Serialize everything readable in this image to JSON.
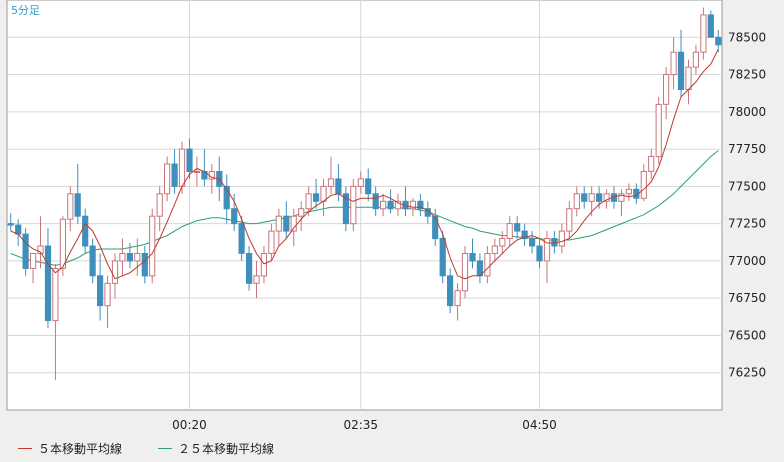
{
  "chart_data": {
    "type": "candlestick",
    "period_label": "5分足",
    "ylim": [
      76000,
      78750
    ],
    "y_ticks": [
      76250,
      76500,
      76750,
      77000,
      77250,
      77500,
      77750,
      78000,
      78250,
      78500
    ],
    "x_ticks": [
      {
        "index": 24,
        "label": "00:20"
      },
      {
        "index": 47,
        "label": "02:35"
      },
      {
        "index": 71,
        "label": "04:50"
      }
    ],
    "grid": true,
    "colors": {
      "up_border": "#c9747a",
      "down_fill": "#3f8fbd",
      "ma5": "#c0392b",
      "ma25": "#2e9e7a",
      "grid": "#d7d7d7",
      "plot_bg": "#ffffff"
    },
    "legend": [
      {
        "label": "５本移動平均線",
        "color": "#c0392b"
      },
      {
        "label": "２５本移動平均線",
        "color": "#2e9e7a"
      }
    ],
    "candles": [
      [
        77250,
        77320,
        77200,
        77240
      ],
      [
        77240,
        77280,
        77100,
        77180
      ],
      [
        77180,
        77220,
        76900,
        76950
      ],
      [
        76950,
        77050,
        76850,
        77050
      ],
      [
        77050,
        77300,
        76950,
        77100
      ],
      [
        77100,
        77220,
        76550,
        76600
      ],
      [
        76600,
        76980,
        76200,
        76950
      ],
      [
        76950,
        77300,
        76900,
        77280
      ],
      [
        77280,
        77500,
        77200,
        77450
      ],
      [
        77450,
        77650,
        77250,
        77300
      ],
      [
        77300,
        77350,
        77050,
        77100
      ],
      [
        77100,
        77150,
        76850,
        76900
      ],
      [
        76900,
        77050,
        76600,
        76700
      ],
      [
        76700,
        76900,
        76550,
        76850
      ],
      [
        76850,
        77050,
        76750,
        77000
      ],
      [
        77000,
        77150,
        76900,
        77050
      ],
      [
        77050,
        77120,
        76950,
        77000
      ],
      [
        77000,
        77150,
        76900,
        77050
      ],
      [
        77050,
        77100,
        76850,
        76900
      ],
      [
        76900,
        77350,
        76850,
        77300
      ],
      [
        77300,
        77500,
        77200,
        77450
      ],
      [
        77450,
        77700,
        77400,
        77650
      ],
      [
        77650,
        77750,
        77450,
        77500
      ],
      [
        77500,
        77800,
        77450,
        77750
      ],
      [
        77750,
        77820,
        77550,
        77600
      ],
      [
        77600,
        77700,
        77500,
        77600
      ],
      [
        77600,
        77750,
        77500,
        77550
      ],
      [
        77550,
        77650,
        77450,
        77600
      ],
      [
        77600,
        77700,
        77400,
        77500
      ],
      [
        77500,
        77580,
        77250,
        77350
      ],
      [
        77350,
        77450,
        77200,
        77250
      ],
      [
        77250,
        77300,
        77000,
        77050
      ],
      [
        77050,
        77100,
        76800,
        76850
      ],
      [
        76850,
        77000,
        76750,
        76900
      ],
      [
        76900,
        77100,
        76850,
        77050
      ],
      [
        77050,
        77250,
        77000,
        77200
      ],
      [
        77200,
        77350,
        77100,
        77300
      ],
      [
        77300,
        77400,
        77150,
        77200
      ],
      [
        77200,
        77350,
        77100,
        77300
      ],
      [
        77300,
        77400,
        77200,
        77350
      ],
      [
        77350,
        77500,
        77300,
        77450
      ],
      [
        77450,
        77550,
        77350,
        77400
      ],
      [
        77400,
        77550,
        77300,
        77500
      ],
      [
        77500,
        77700,
        77450,
        77550
      ],
      [
        77550,
        77650,
        77400,
        77450
      ],
      [
        77450,
        77500,
        77200,
        77250
      ],
      [
        77250,
        77550,
        77200,
        77500
      ],
      [
        77500,
        77600,
        77450,
        77550
      ],
      [
        77550,
        77620,
        77400,
        77450
      ],
      [
        77450,
        77500,
        77300,
        77350
      ],
      [
        77350,
        77450,
        77300,
        77400
      ],
      [
        77400,
        77480,
        77320,
        77350
      ],
      [
        77350,
        77450,
        77300,
        77400
      ],
      [
        77400,
        77500,
        77300,
        77350
      ],
      [
        77350,
        77420,
        77300,
        77400
      ],
      [
        77400,
        77450,
        77300,
        77350
      ],
      [
        77350,
        77400,
        77250,
        77300
      ],
      [
        77300,
        77350,
        77100,
        77150
      ],
      [
        77150,
        77200,
        76850,
        76900
      ],
      [
        76900,
        76950,
        76650,
        76700
      ],
      [
        76700,
        76850,
        76600,
        76800
      ],
      [
        76800,
        77100,
        76750,
        77050
      ],
      [
        77050,
        77150,
        76950,
        77000
      ],
      [
        77000,
        77050,
        76850,
        76900
      ],
      [
        76900,
        77100,
        76850,
        77050
      ],
      [
        77050,
        77150,
        77000,
        77100
      ],
      [
        77100,
        77200,
        77050,
        77150
      ],
      [
        77150,
        77300,
        77100,
        77250
      ],
      [
        77250,
        77300,
        77150,
        77200
      ],
      [
        77200,
        77250,
        77100,
        77150
      ],
      [
        77150,
        77200,
        77050,
        77100
      ],
      [
        77100,
        77150,
        76950,
        77000
      ],
      [
        77000,
        77200,
        76850,
        77150
      ],
      [
        77150,
        77200,
        77050,
        77100
      ],
      [
        77100,
        77250,
        77050,
        77200
      ],
      [
        77200,
        77400,
        77150,
        77350
      ],
      [
        77350,
        77500,
        77300,
        77450
      ],
      [
        77450,
        77500,
        77350,
        77400
      ],
      [
        77400,
        77500,
        77300,
        77450
      ],
      [
        77450,
        77500,
        77350,
        77400
      ],
      [
        77400,
        77480,
        77350,
        77450
      ],
      [
        77450,
        77500,
        77350,
        77400
      ],
      [
        77400,
        77480,
        77300,
        77450
      ],
      [
        77450,
        77520,
        77400,
        77480
      ],
      [
        77480,
        77520,
        77380,
        77420
      ],
      [
        77420,
        77650,
        77400,
        77600
      ],
      [
        77600,
        77750,
        77550,
        77700
      ],
      [
        77700,
        78100,
        77650,
        78050
      ],
      [
        78050,
        78300,
        77950,
        78250
      ],
      [
        78250,
        78500,
        78150,
        78400
      ],
      [
        78400,
        78550,
        78100,
        78150
      ],
      [
        78150,
        78350,
        78050,
        78300
      ],
      [
        78300,
        78450,
        78250,
        78400
      ],
      [
        78400,
        78700,
        78350,
        78650
      ],
      [
        78650,
        78680,
        78500,
        78500
      ],
      [
        78500,
        78550,
        78400,
        78450
      ]
    ],
    "ma5": [
      77200,
      77180,
      77120,
      77080,
      77060,
      76980,
      76920,
      76960,
      77060,
      77150,
      77250,
      77200,
      77100,
      76980,
      76880,
      76900,
      76920,
      76960,
      77000,
      77050,
      77150,
      77260,
      77380,
      77500,
      77580,
      77620,
      77600,
      77560,
      77550,
      77480,
      77400,
      77280,
      77150,
      77050,
      76980,
      77000,
      77100,
      77150,
      77220,
      77280,
      77330,
      77370,
      77400,
      77440,
      77450,
      77420,
      77400,
      77420,
      77420,
      77420,
      77440,
      77420,
      77390,
      77370,
      77360,
      77360,
      77340,
      77290,
      77180,
      77020,
      76900,
      76880,
      76900,
      76900,
      76950,
      77000,
      77050,
      77100,
      77140,
      77160,
      77170,
      77150,
      77120,
      77120,
      77130,
      77150,
      77200,
      77270,
      77330,
      77380,
      77410,
      77430,
      77440,
      77430,
      77440,
      77480,
      77530,
      77630,
      77780,
      77950,
      78100,
      78150,
      78200,
      78270,
      78320,
      78420
    ],
    "ma25": [
      77050,
      77030,
      77010,
      77000,
      76990,
      76980,
      76970,
      76980,
      77000,
      77020,
      77050,
      77070,
      77080,
      77080,
      77080,
      77080,
      77090,
      77100,
      77110,
      77130,
      77150,
      77170,
      77200,
      77230,
      77250,
      77270,
      77280,
      77290,
      77290,
      77280,
      77270,
      77260,
      77250,
      77250,
      77260,
      77270,
      77280,
      77290,
      77300,
      77320,
      77330,
      77340,
      77350,
      77360,
      77360,
      77360,
      77360,
      77360,
      77360,
      77360,
      77360,
      77360,
      77360,
      77350,
      77350,
      77340,
      77330,
      77310,
      77290,
      77270,
      77250,
      77230,
      77220,
      77200,
      77190,
      77180,
      77170,
      77170,
      77160,
      77160,
      77150,
      77150,
      77140,
      77140,
      77140,
      77140,
      77150,
      77160,
      77170,
      77190,
      77210,
      77230,
      77250,
      77270,
      77290,
      77310,
      77340,
      77370,
      77410,
      77450,
      77500,
      77550,
      77600,
      77650,
      77700,
      77740
    ]
  }
}
